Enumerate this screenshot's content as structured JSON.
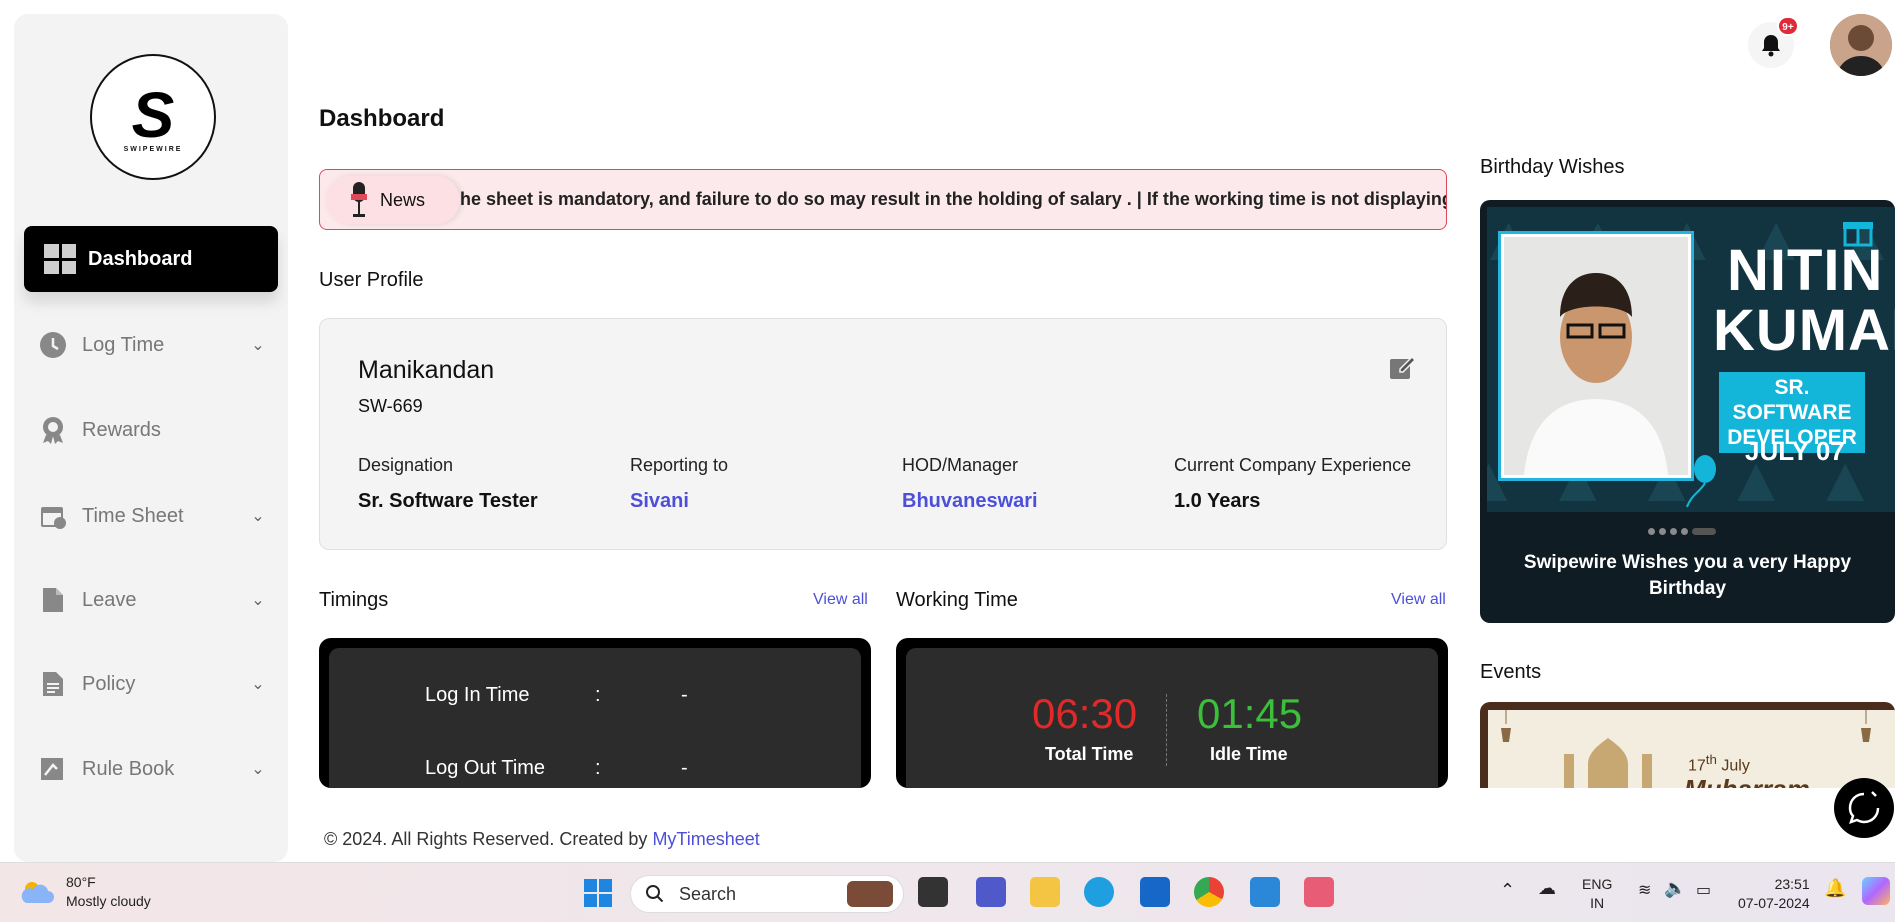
{
  "header": {
    "notification_count": "9+"
  },
  "logo": {
    "letter": "S",
    "brand": "SWIPEWIRE"
  },
  "sidebar": {
    "items": [
      {
        "label": "Dashboard",
        "icon": "dashboard-grid-icon",
        "active": true
      },
      {
        "label": "Log Time",
        "icon": "clock-icon",
        "expandable": true
      },
      {
        "label": "Rewards",
        "icon": "award-icon",
        "expandable": false
      },
      {
        "label": "Time Sheet",
        "icon": "calendar-icon",
        "expandable": true
      },
      {
        "label": "Leave",
        "icon": "document-icon",
        "expandable": true
      },
      {
        "label": "Policy",
        "icon": "policy-icon",
        "expandable": true
      },
      {
        "label": "Rule Book",
        "icon": "rulebook-icon",
        "expandable": true
      }
    ]
  },
  "page": {
    "title": "Dashboard"
  },
  "news": {
    "label": "News",
    "text": "he sheet is mandatory, and failure to do so may result in the holding of salary . | If the working time is not displaying cor"
  },
  "profile": {
    "section_title": "User Profile",
    "name": "Manikandan",
    "employee_id": "SW-669",
    "fields": [
      {
        "label": "Designation",
        "value": "Sr. Software Tester"
      },
      {
        "label": "Reporting to",
        "value": "Sivani"
      },
      {
        "label": "HOD/Manager",
        "value": "Bhuvaneswari"
      },
      {
        "label": "Current Company Experience",
        "value": "1.0 Years"
      }
    ]
  },
  "timings": {
    "title": "Timings",
    "view_all": "View all",
    "rows": [
      {
        "label": "Log In Time",
        "sep": ":",
        "value": "-"
      },
      {
        "label": "Log Out Time",
        "sep": ":",
        "value": "-"
      }
    ]
  },
  "working_time": {
    "title": "Working Time",
    "view_all": "View all",
    "total": {
      "value": "06:30",
      "label": "Total Time",
      "color": "#e02a2a"
    },
    "idle": {
      "value": "01:45",
      "label": "Idle Time",
      "color": "#3cbf3a"
    }
  },
  "birthday": {
    "title": "Birthday Wishes",
    "name_line1": "NITIN",
    "name_line2": "KUMAR",
    "role": "SR. SOFTWARE DEVELOPER",
    "date": "JULY 07",
    "message": "Swipewire Wishes you a very Happy Birthday"
  },
  "events": {
    "title": "Events",
    "date_prefix": "17",
    "date_suffix": "th",
    "date_month": "July",
    "event_name": "Muharram"
  },
  "footer": {
    "text": "© 2024. All Rights Reserved. Created by ",
    "link": "MyTimesheet"
  },
  "taskbar": {
    "weather_temp": "80°F",
    "weather_desc": "Mostly cloudy",
    "search_label": "Search",
    "lang_line1": "ENG",
    "lang_line2": "IN",
    "time": "23:51",
    "date": "07-07-2024"
  },
  "colors": {
    "accent_link": "#4d4fd8",
    "news_border": "#e0495a",
    "brand_cyan": "#13b5d9"
  }
}
